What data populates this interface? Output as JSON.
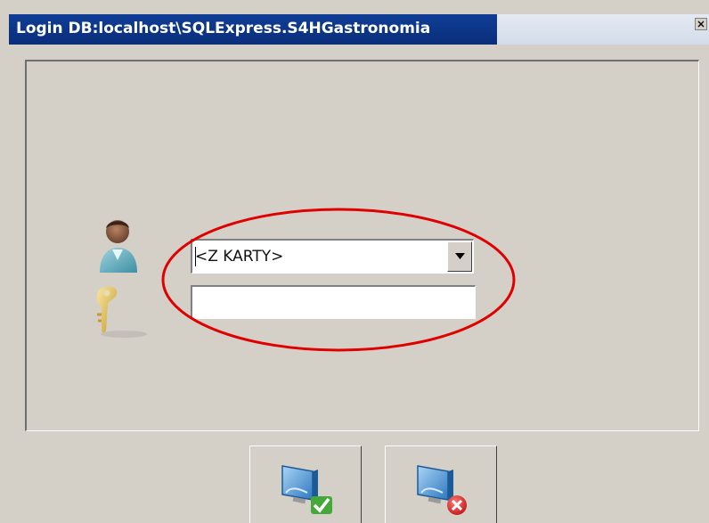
{
  "window": {
    "title": "Login DB:localhost\\SQLExpress.S4HGastronomia"
  },
  "login_form": {
    "user_select": {
      "selected_value": "<Z KARTY>"
    },
    "password_field": {
      "value": ""
    }
  },
  "icons": {
    "user": "user-icon",
    "key": "key-icon",
    "ok": "login-confirm-icon",
    "cancel": "login-cancel-icon",
    "close": "close-icon",
    "dropdown": "chevron-down-icon"
  },
  "colors": {
    "title_bar": "#0f3e96",
    "title_text": "#ffffff",
    "dialog_background": "#d4d0c8",
    "annotation": "#e00000"
  }
}
